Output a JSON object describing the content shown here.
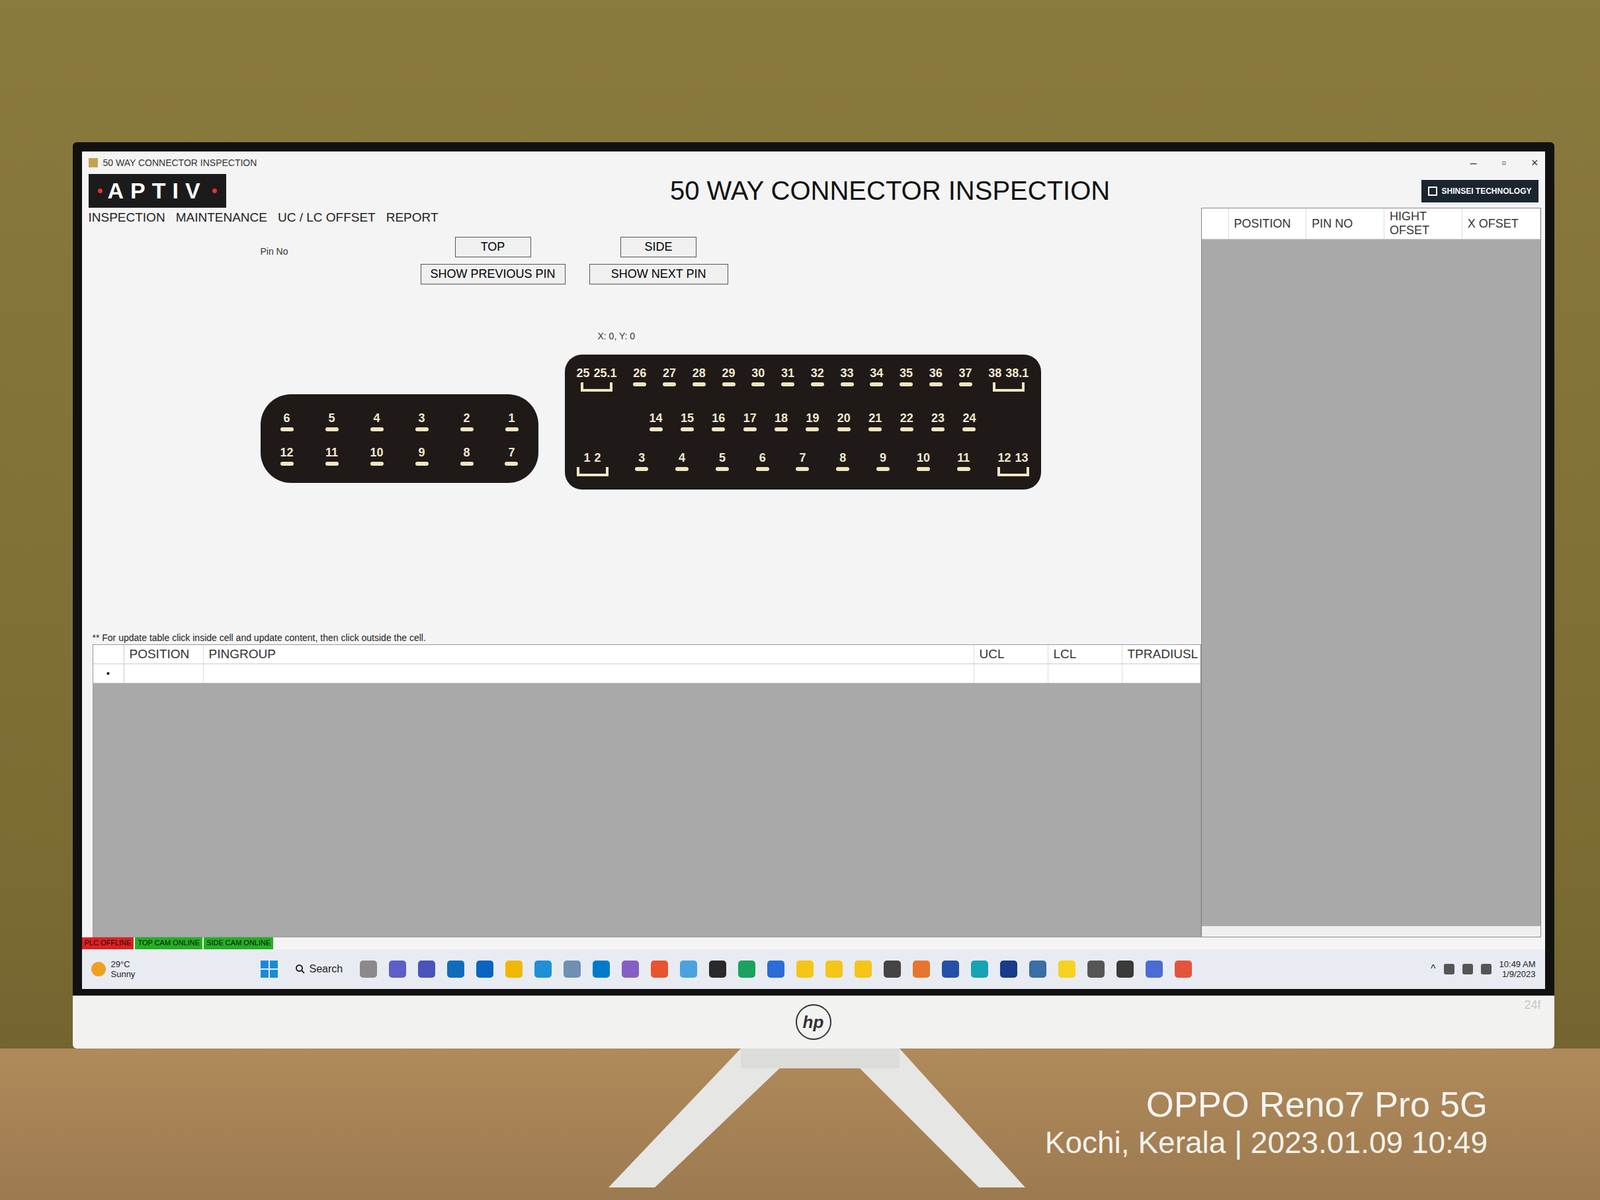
{
  "window": {
    "title": "50 WAY CONNECTOR INSPECTION",
    "controls": [
      "–",
      "▫",
      "×"
    ]
  },
  "logo": "APTIV",
  "brand": "SHINSEI TECHNOLOGY",
  "heading": "50 WAY CONNECTOR INSPECTION",
  "menu": [
    "INSPECTION",
    "MAINTENANCE",
    "UC / LC OFFSET",
    "REPORT"
  ],
  "pin_label": "Pin No",
  "buttons": {
    "top": "TOP",
    "side": "SIDE",
    "prev": "SHOW PREVIOUS PIN",
    "next": "SHOW NEXT PIN"
  },
  "coords": "X: 0, Y: 0",
  "small_connector": {
    "rows": [
      [
        "6",
        "5",
        "4",
        "3",
        "2",
        "1"
      ],
      [
        "12",
        "11",
        "10",
        "9",
        "8",
        "7"
      ]
    ]
  },
  "large_connector": {
    "rows": [
      [
        [
          "25",
          "25.1"
        ],
        [
          "26"
        ],
        [
          "27"
        ],
        [
          "28"
        ],
        [
          "29"
        ],
        [
          "30"
        ],
        [
          "31"
        ],
        [
          "32"
        ],
        [
          "33"
        ],
        [
          "34"
        ],
        [
          "35"
        ],
        [
          "36"
        ],
        [
          "37"
        ],
        [
          "38",
          "38.1"
        ]
      ],
      [
        [
          "14"
        ],
        [
          "15"
        ],
        [
          "16"
        ],
        [
          "17"
        ],
        [
          "18"
        ],
        [
          "19"
        ],
        [
          "20"
        ],
        [
          "21"
        ],
        [
          "22"
        ],
        [
          "23"
        ],
        [
          "24"
        ]
      ],
      [
        [
          "1",
          "2"
        ],
        [
          "3"
        ],
        [
          "4"
        ],
        [
          "5"
        ],
        [
          "6"
        ],
        [
          "7"
        ],
        [
          "8"
        ],
        [
          "9"
        ],
        [
          "10"
        ],
        [
          "11"
        ],
        [
          "12",
          "13"
        ]
      ]
    ]
  },
  "offset_table": {
    "columns": [
      "POSITION",
      "PIN NO",
      "HIGHT OFSET",
      "X OFSET"
    ]
  },
  "group_table": {
    "note": "** For update table click inside cell and update content, then click outside the cell.",
    "columns": [
      "POSITION",
      "PINGROUP",
      "UCL",
      "LCL",
      "TPRADIUSL"
    ],
    "new_row_marker": "•"
  },
  "status": [
    {
      "label": "PLC OFFLINE",
      "color": "#e02020"
    },
    {
      "label": "TOP CAM ONLINE",
      "color": "#22b022"
    },
    {
      "label": "SIDE CAM ONLINE",
      "color": "#22b022"
    }
  ],
  "taskbar": {
    "weather": {
      "temp": "29°C",
      "condition": "Sunny"
    },
    "search": "Search",
    "apps": [
      {
        "color": "#8a8a8a"
      },
      {
        "color": "#5b5fc7"
      },
      {
        "color": "#4b53bc"
      },
      {
        "color": "#0f6cbd"
      },
      {
        "color": "#0a64c2"
      },
      {
        "color": "#f2b705"
      },
      {
        "color": "#1e90d6"
      },
      {
        "color": "#6f8fb3"
      },
      {
        "color": "#007acc"
      },
      {
        "color": "#865fc5"
      },
      {
        "color": "#e8542e"
      },
      {
        "color": "#4aa3df"
      },
      {
        "color": "#2a2a2a"
      },
      {
        "color": "#1aa260"
      },
      {
        "color": "#2b6cd6"
      },
      {
        "color": "#f5c518"
      },
      {
        "color": "#f5c518"
      },
      {
        "color": "#f5c518"
      },
      {
        "color": "#444444"
      },
      {
        "color": "#e8742e"
      },
      {
        "color": "#2450a8"
      },
      {
        "color": "#16a3b5"
      },
      {
        "color": "#1a3a8a"
      },
      {
        "color": "#3a6ea5"
      },
      {
        "color": "#f7d21e"
      },
      {
        "color": "#555555"
      },
      {
        "color": "#3a3a3a"
      },
      {
        "color": "#4a6cd4"
      },
      {
        "color": "#e5533d"
      }
    ],
    "tray": "^",
    "time": "10:49 AM",
    "date": "1/9/2023"
  },
  "monitor": {
    "brand": "hp",
    "model": "24f"
  },
  "watermark": {
    "device": "OPPO Reno7 Pro 5G",
    "location": "Kochi, Kerala",
    "datetime": "2023.01.09 10:49"
  }
}
